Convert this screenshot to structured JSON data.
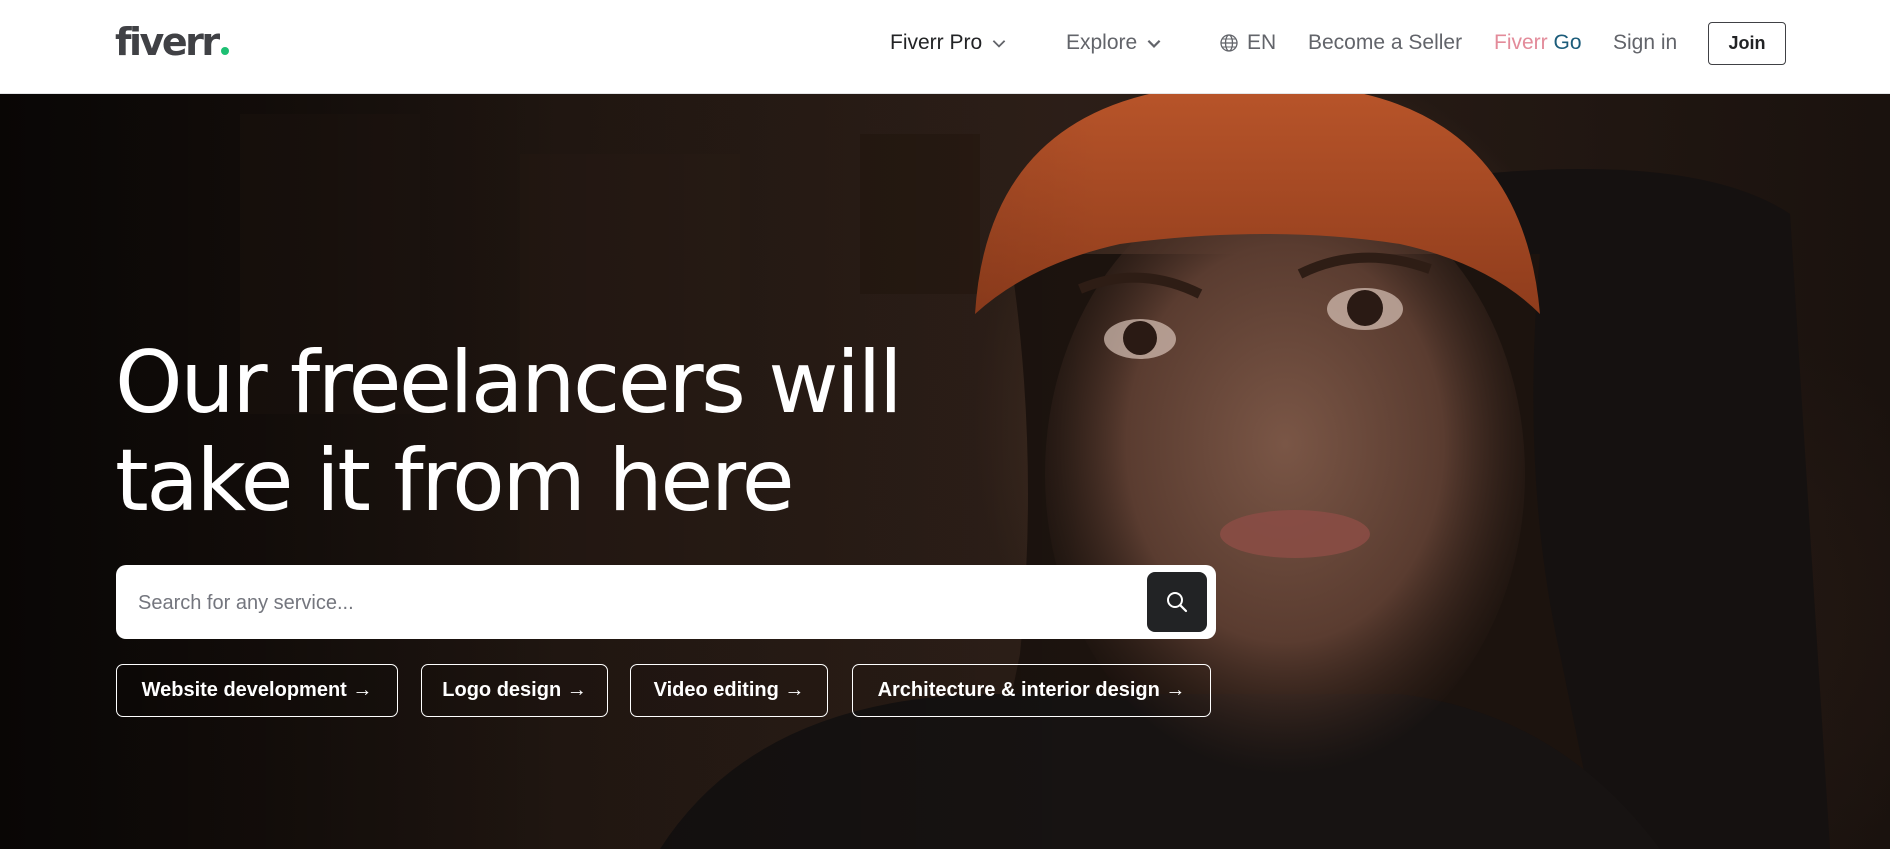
{
  "header": {
    "logo_text": "fiverr",
    "nav": {
      "pro": "Fiverr Pro",
      "explore": "Explore",
      "language": "EN",
      "become_seller": "Become a Seller",
      "fiverr_go_a": "Fiverr",
      "fiverr_go_b": "Go",
      "sign_in": "Sign in",
      "join": "Join"
    },
    "icons": [
      "chevron-down-icon",
      "globe-icon"
    ]
  },
  "hero": {
    "headline_line1": "Our freelancers will",
    "headline_line2": "take it from here",
    "search": {
      "placeholder": "Search for any service...",
      "value": "",
      "button_icon": "search-icon"
    },
    "chips": [
      {
        "label": "Website development →"
      },
      {
        "label": "Logo design →"
      },
      {
        "label": "Video editing →"
      },
      {
        "label": "Architecture & interior design →"
      }
    ]
  },
  "colors": {
    "brand_green": "#1dbf73",
    "text_dark": "#222325",
    "text_grey": "#62646a",
    "fiverr_go_pink": "#e38b9a",
    "fiverr_go_blue": "#1b5c7a",
    "hero_bg": "#1e1510"
  }
}
